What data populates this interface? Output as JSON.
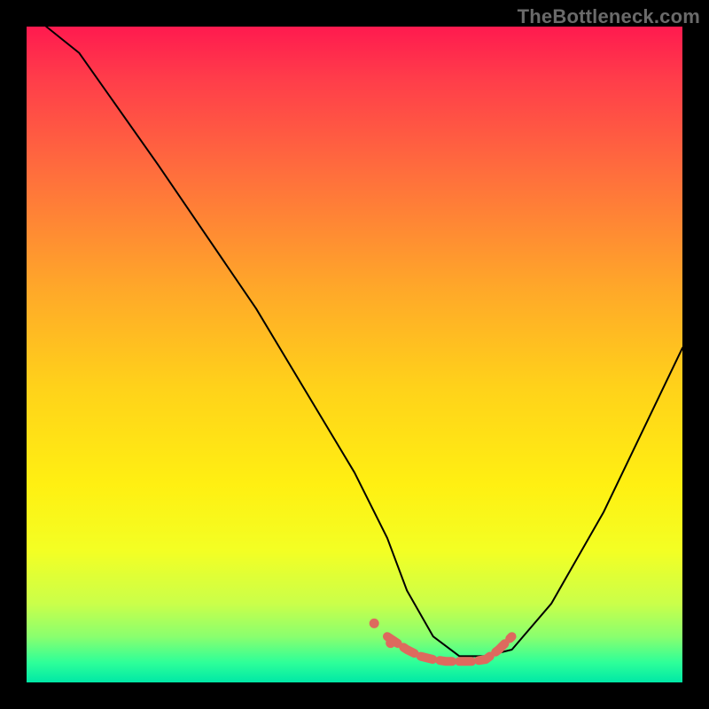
{
  "watermark": "TheBottleneck.com",
  "chart_data": {
    "type": "line",
    "title": "",
    "xlabel": "",
    "ylabel": "",
    "xlim": [
      0,
      100
    ],
    "ylim": [
      0,
      100
    ],
    "series": [
      {
        "name": "curve",
        "x": [
          3,
          8,
          20,
          35,
          50,
          55,
          58,
          62,
          66,
          70,
          74,
          80,
          88,
          100
        ],
        "y": [
          100,
          96,
          79,
          57,
          32,
          22,
          14,
          7,
          4,
          4,
          5,
          12,
          26,
          51
        ],
        "stroke": "#000000",
        "stroke_width": 2
      },
      {
        "name": "floor-markers",
        "x": [
          55,
          58,
          60,
          62,
          64,
          66,
          68,
          70,
          72,
          74
        ],
        "y": [
          7,
          5,
          4,
          3.5,
          3.2,
          3.2,
          3.2,
          3.5,
          5,
          7
        ],
        "stroke": "#dd6a5e",
        "stroke_width": 10
      }
    ],
    "colors": {
      "gradient_top": "#ff1a4f",
      "gradient_mid": "#fff012",
      "gradient_bottom": "#00e8a6",
      "curve": "#000000",
      "markers": "#dd6a5e",
      "frame": "#000000"
    }
  }
}
